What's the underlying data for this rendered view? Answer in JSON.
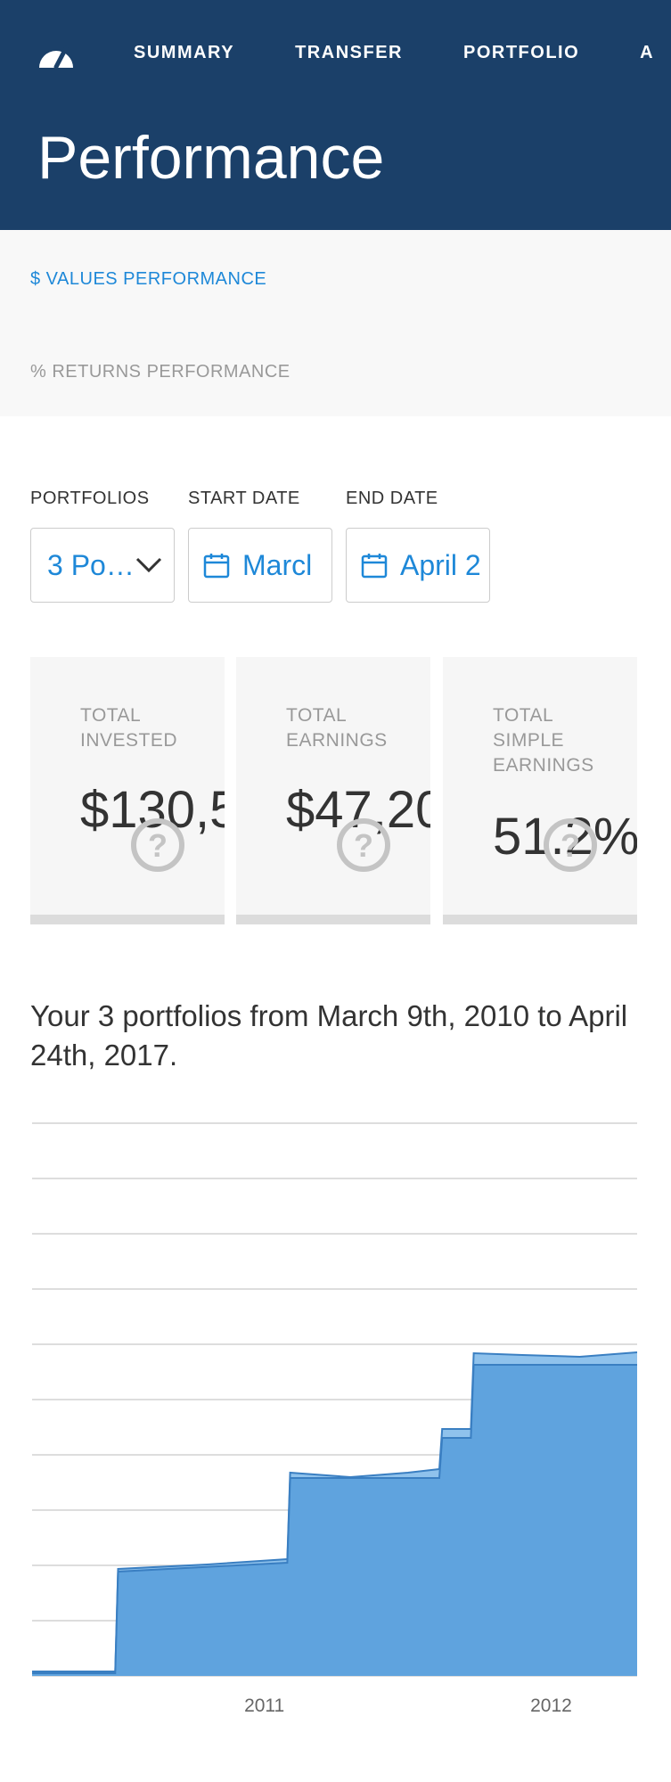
{
  "nav": {
    "items": [
      "SUMMARY",
      "TRANSFER",
      "PORTFOLIO",
      "A"
    ]
  },
  "page_title": "Performance",
  "subnav": {
    "values_link": "$ VALUES PERFORMANCE",
    "returns_link": "% RETURNS PERFORMANCE"
  },
  "filters": {
    "portfolios_label": "PORTFOLIOS",
    "portfolios_value": "3 Po…",
    "start_label": "START DATE",
    "start_value": "Marcl",
    "end_label": "END DATE",
    "end_value": "April 2"
  },
  "cards": [
    {
      "label_lines": [
        "TOTAL",
        "INVESTED"
      ],
      "value": "$130,5"
    },
    {
      "label_lines": [
        "TOTAL",
        "EARNINGS"
      ],
      "value": "$47,20"
    },
    {
      "label_lines": [
        "TOTAL",
        "SIMPLE",
        "EARNINGS"
      ],
      "value": "51.2%"
    }
  ],
  "caption": "Your 3 portfolios from March 9th, 2010 to April 24th, 2017.",
  "colors": {
    "header_bg": "#1b4069",
    "accent": "#1e88d8",
    "chart_fill": "#5fa3de",
    "chart_earnings_fill": "#8fc2ec"
  },
  "chart_data": {
    "type": "area",
    "x_tick_labels": [
      "2011",
      "2012"
    ],
    "grid": true,
    "series": [
      {
        "values": [
          [
            2010.19,
            3
          ],
          [
            2010.48,
            3
          ],
          [
            2010.49,
            117
          ],
          [
            2011.08,
            127
          ],
          [
            2011.09,
            222
          ],
          [
            2011.5,
            222
          ],
          [
            2011.61,
            222
          ],
          [
            2011.62,
            267
          ],
          [
            2011.72,
            267
          ],
          [
            2011.73,
            349
          ],
          [
            2012.3,
            349
          ]
        ]
      },
      {
        "values": [
          [
            2010.19,
            5
          ],
          [
            2010.48,
            5
          ],
          [
            2010.49,
            120
          ],
          [
            2010.8,
            125
          ],
          [
            2011.08,
            131
          ],
          [
            2011.09,
            228
          ],
          [
            2011.3,
            223
          ],
          [
            2011.5,
            228
          ],
          [
            2011.61,
            232
          ],
          [
            2011.62,
            277
          ],
          [
            2011.72,
            277
          ],
          [
            2011.73,
            362
          ],
          [
            2011.9,
            360
          ],
          [
            2012.1,
            358
          ],
          [
            2012.3,
            363
          ]
        ]
      }
    ]
  }
}
